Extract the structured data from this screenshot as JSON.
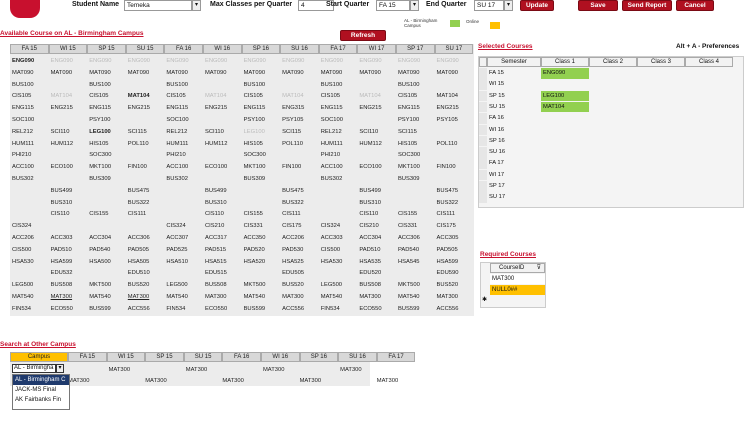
{
  "header": {
    "student_name_label": "Student Name",
    "student_name_value": "Temeka",
    "max_classes_label": "Max Classes per Quarter",
    "max_classes_value": "4",
    "start_quarter_label": "Start Quarter",
    "start_quarter_value": "FA 15",
    "end_quarter_label": "End Quarter",
    "end_quarter_value": "SU 17",
    "update_label": "Update",
    "save_label": "Save",
    "send_report_label": "Send Report",
    "cancel_label": "Cancel",
    "legend_campus_label": "AL - Birmingham Campus",
    "legend_online_label": "Online",
    "legend_campus_color": "#92d050",
    "legend_online_color": "#ffc000"
  },
  "available": {
    "title": "Available Course on AL - Birmingham Campus",
    "refresh_label": "Refresh",
    "quarters": [
      "FA 15",
      "WI 15",
      "SP 15",
      "SU 15",
      "FA 16",
      "WI 16",
      "SP 16",
      "SU 16",
      "FA 17",
      "WI 17",
      "SP 17",
      "SU 17"
    ],
    "rows": [
      [
        "ENG090",
        "ENG090",
        "ENG090",
        "ENG090",
        "ENG090",
        "ENG090",
        "ENG090",
        "ENG090",
        "ENG090",
        "ENG090",
        "ENG090",
        "ENG090"
      ],
      [
        "MAT090",
        "MAT090",
        "MAT090",
        "MAT090",
        "MAT090",
        "MAT090",
        "MAT090",
        "MAT090",
        "MAT090",
        "MAT090",
        "MAT090",
        "MAT090"
      ],
      [
        "BUS100",
        "",
        "BUS100",
        "",
        "BUS100",
        "",
        "BUS100",
        "",
        "BUS100",
        "",
        "BUS100",
        ""
      ],
      [
        "CIS105",
        "MAT104",
        "CIS105",
        "MAT104",
        "CIS105",
        "MAT104",
        "CIS105",
        "MAT104",
        "CIS105",
        "MAT104",
        "CIS105",
        "MAT104"
      ],
      [
        "ENG115",
        "ENG215",
        "ENG115",
        "ENG215",
        "ENG115",
        "ENG215",
        "ENG115",
        "ENG315",
        "ENG115",
        "ENG215",
        "ENG115",
        "ENG215"
      ],
      [
        "SOC100",
        "",
        "PSY100",
        "",
        "SOC100",
        "",
        "PSY100",
        "PSY105",
        "SOC100",
        "",
        "PSY100",
        "PSY105"
      ],
      [
        "REL212",
        "SCI110",
        "LEG100",
        "SCI115",
        "REL212",
        "SCI110",
        "LEG100",
        "SCI115",
        "REL212",
        "SCI110",
        "SCI115",
        ""
      ],
      [
        "HUM111",
        "HUM112",
        "HIS105",
        "POL110",
        "HUM111",
        "HUM112",
        "HIS105",
        "POL110",
        "HUM111",
        "HUM112",
        "HIS105",
        "POL110"
      ],
      [
        "PHI210",
        "",
        "SOC300",
        "",
        "PHI210",
        "",
        "SOC300",
        "",
        "PHI210",
        "",
        "SOC300",
        ""
      ],
      [
        "ACC100",
        "ECO100",
        "MKT100",
        "FIN100",
        "ACC100",
        "ECO100",
        "MKT100",
        "FIN100",
        "ACC100",
        "ECO100",
        "MKT100",
        "FIN100"
      ],
      [
        "BUS302",
        "",
        "BUS309",
        "",
        "BUS302",
        "",
        "BUS309",
        "",
        "BUS302",
        "",
        "BUS309",
        ""
      ],
      [
        "",
        "BUS499",
        "",
        "BUS475",
        "",
        "BUS499",
        "",
        "BUS475",
        "",
        "BUS499",
        "",
        "BUS475"
      ],
      [
        "",
        "BUS310",
        "",
        "BUS322",
        "",
        "BUS310",
        "",
        "BUS322",
        "",
        "BUS310",
        "",
        "BUS322"
      ],
      [
        "",
        "CIS110",
        "CIS155",
        "CIS111",
        "",
        "CIS110",
        "CIS155",
        "CIS111",
        "",
        "CIS110",
        "CIS155",
        "CIS111"
      ],
      [
        "CIS324",
        "",
        "",
        "",
        "CIS324",
        "CIS210",
        "CIS331",
        "CIS175",
        "CIS324",
        "CIS210",
        "CIS331",
        "CIS175"
      ],
      [
        "ACC206",
        "ACC303",
        "ACC304",
        "ACC306",
        "ACC307",
        "ACC317",
        "ACC350",
        "ACC206",
        "ACC303",
        "ACC304",
        "ACC306",
        "ACC305"
      ],
      [
        "CIS500",
        "PAD510",
        "PAD540",
        "PAD505",
        "PAD525",
        "PAD515",
        "PAD520",
        "PAD530",
        "CIS500",
        "PAD510",
        "PAD540",
        "PAD505"
      ],
      [
        "HSA530",
        "HSA599",
        "HSA500",
        "HSA505",
        "HSA510",
        "HSA515",
        "HSA520",
        "HSA525",
        "HSA530",
        "HSA535",
        "HSA545",
        "HSA599"
      ],
      [
        "",
        "EDU532",
        "",
        "EDU510",
        "",
        "EDU515",
        "",
        "EDU505",
        "",
        "EDU520",
        "",
        "EDU590"
      ],
      [
        "LEG500",
        "BUS508",
        "MKT500",
        "BUS520",
        "LEG500",
        "BUS508",
        "MKT500",
        "BUS520",
        "LEG500",
        "BUS508",
        "MKT500",
        "BUS520"
      ],
      [
        "MAT540",
        "MAT300",
        "MAT540",
        "MAT300",
        "MAT540",
        "MAT300",
        "MAT540",
        "MAT300",
        "MAT540",
        "MAT300",
        "MAT540",
        "MAT300"
      ],
      [
        "FIN534",
        "ECO550",
        "BUS599",
        "ACC556",
        "FIN534",
        "ECO550",
        "BUS599",
        "ACC556",
        "FIN534",
        "ECO550",
        "BUS599",
        "ACC556"
      ]
    ]
  },
  "selected": {
    "title": "Selected Courses",
    "hint": "Alt + A - Preferences",
    "columns": [
      "Semester",
      "Class 1",
      "Class 2",
      "Class 3",
      "Class 4"
    ],
    "rows": [
      {
        "semester": "FA 15",
        "class1": "ENG090",
        "status": "campus"
      },
      {
        "semester": "WI 15",
        "class1": "",
        "status": ""
      },
      {
        "semester": "SP 15",
        "class1": "LEG100",
        "status": "campus"
      },
      {
        "semester": "SU 15",
        "class1": "MAT104",
        "status": "campus"
      },
      {
        "semester": "FA 16",
        "class1": "",
        "status": ""
      },
      {
        "semester": "WI 16",
        "class1": "",
        "status": ""
      },
      {
        "semester": "SP 16",
        "class1": "",
        "status": ""
      },
      {
        "semester": "SU 16",
        "class1": "",
        "status": ""
      },
      {
        "semester": "FA 17",
        "class1": "",
        "status": ""
      },
      {
        "semester": "WI 17",
        "class1": "",
        "status": ""
      },
      {
        "semester": "SP 17",
        "class1": "",
        "status": ""
      },
      {
        "semester": "SU 17",
        "class1": "",
        "status": ""
      }
    ]
  },
  "required": {
    "title": "Required Courses",
    "column": "CourseID",
    "rows": [
      "MAT300",
      "NULL0##"
    ],
    "new_row_marker": "✱"
  },
  "search": {
    "title": "Search at Other Campus",
    "campus_col": "Campus",
    "quarters": [
      "FA 15",
      "WI 15",
      "SP 15",
      "SU 15",
      "FA 16",
      "WI 16",
      "SP 16",
      "SU 16",
      "FA 17"
    ],
    "campus_value": "AL - Birmingha",
    "dropdown_options": [
      "AL - Birmingham C",
      "JACK-MS Final",
      "AK Fairbanks Fin"
    ],
    "rows": [
      [
        "",
        "MAT300",
        "",
        "MAT300",
        "",
        "MAT300",
        "",
        "MAT300",
        ""
      ],
      [
        "MAT300",
        "",
        "MAT300",
        "",
        "MAT300",
        "",
        "MAT300",
        "",
        "MAT300"
      ]
    ]
  }
}
